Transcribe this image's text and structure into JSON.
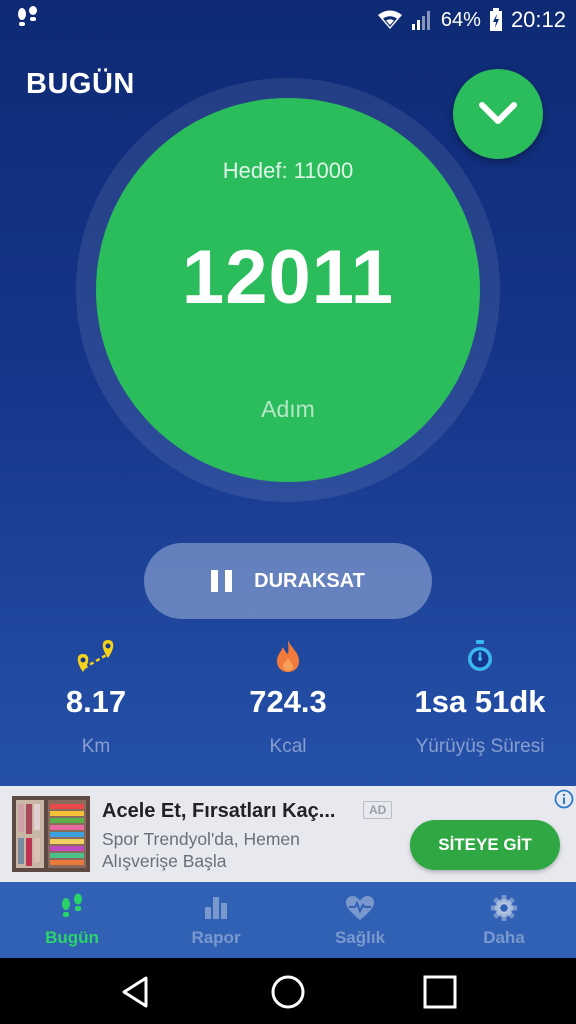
{
  "status_bar": {
    "battery_percent": "64%",
    "time": "20:12"
  },
  "header": {
    "title": "BUGÜN"
  },
  "progress": {
    "goal_label": "Hedef: 11000",
    "steps": "12011",
    "unit": "Adım"
  },
  "pause_button": {
    "label": "DURAKSAT"
  },
  "stats": [
    {
      "icon": "map-route-icon",
      "value": "8.17",
      "label": "Km",
      "color": "#f5d31a"
    },
    {
      "icon": "flame-icon",
      "value": "724.3",
      "label": "Kcal",
      "color": "#f07a3a"
    },
    {
      "icon": "stopwatch-icon",
      "value": "1sa 51dk",
      "label": "Yürüyüş Süresi",
      "color": "#3ab7f0"
    }
  ],
  "ad": {
    "title": "Acele Et, Fırsatları Kaç...",
    "badge": "AD",
    "line1": "Spor Trendyol'da, Hemen",
    "line2": "Alışverişe Başla",
    "cta": "SİTEYE GİT"
  },
  "nav": [
    {
      "label": "Bugün",
      "icon": "footsteps-icon",
      "active": true
    },
    {
      "label": "Rapor",
      "icon": "bar-chart-icon",
      "active": false
    },
    {
      "label": "Sağlık",
      "icon": "heart-pulse-icon",
      "active": false
    },
    {
      "label": "Daha",
      "icon": "gear-icon",
      "active": false
    }
  ],
  "colors": {
    "accent": "#2bbd5c",
    "nav_active": "#2bd46a",
    "background": "#15368a"
  }
}
